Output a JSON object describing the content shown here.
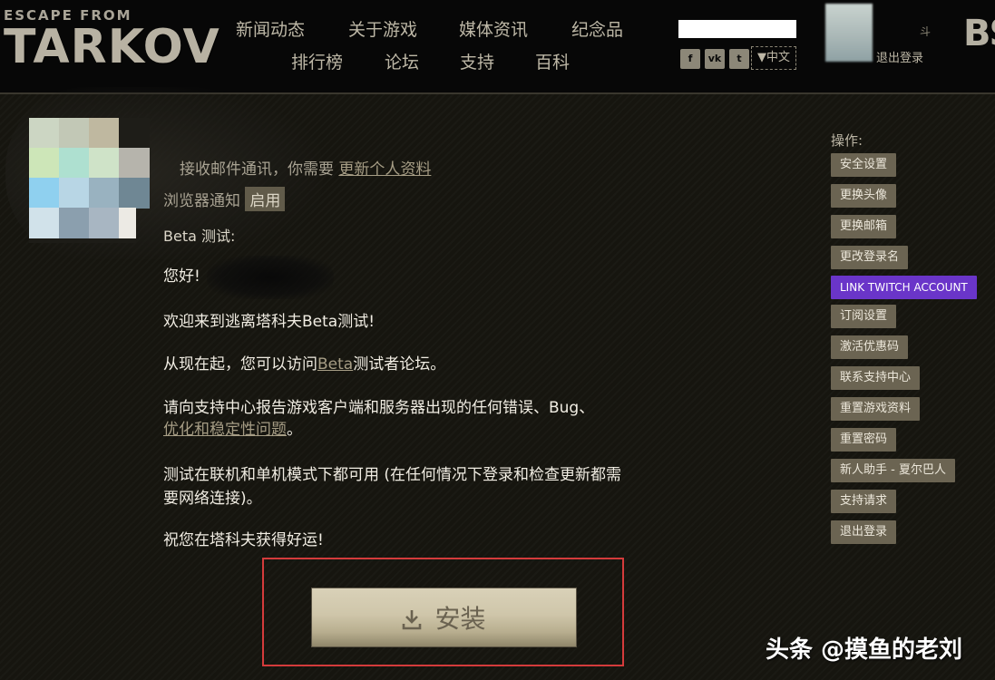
{
  "header": {
    "logo_line1": "ESCAPE FROM",
    "logo_line2": "TARKOV",
    "nav_row1": [
      "新闻动态",
      "关于游戏",
      "媒体资讯",
      "纪念品"
    ],
    "nav_row2": [
      "排行榜",
      "论坛",
      "支持",
      "百科"
    ],
    "social_icons": [
      "facebook-icon",
      "vk-icon",
      "twitter-icon"
    ],
    "language": "▼中文",
    "user_label": "斗",
    "logout": "退出登录",
    "brand_logo": "BSG"
  },
  "profile": {
    "email_notice_prefix": "接收邮件通讯，你需要",
    "email_notice_link": "更新个人资料",
    "browser_notify_label": "浏览器通知",
    "browser_notify_button": "启用",
    "beta_label": "Beta 测试:"
  },
  "message": {
    "greeting": "您好!",
    "welcome": "欢迎来到逃离塔科夫Beta测试!",
    "forum_prefix": "从现在起，您可以访问",
    "forum_link": "Beta",
    "forum_suffix": "测试者论坛。",
    "report_line1": "请向支持中心报告游戏客户端和服务器出现的任何错误、Bug、",
    "report_link": "优化和稳定性问题",
    "report_line2_suffix": "。",
    "modes_line1": "测试在联机和单机模式下都可用 (在任何情况下登录和检查更新都需",
    "modes_line2": "要网络连接)。",
    "good_luck": "祝您在塔科夫获得好运!"
  },
  "install": {
    "label": "安装",
    "icon": "download-icon"
  },
  "sidebar": {
    "title": "操作:",
    "items": [
      "安全设置",
      "更换头像",
      "更换邮箱",
      "更改登录名",
      "LINK TWITCH ACCOUNT",
      "订阅设置",
      "激活优惠码",
      "联系支持中心",
      "重置游戏资料",
      "重置密码",
      "新人助手 - 夏尔巴人",
      "支持请求",
      "退出登录"
    ]
  },
  "watermark": "头条 @摸鱼的老刘",
  "colors": {
    "accent_twitch": "#6a35c9",
    "button_bg": "#6b6452",
    "highlight_border": "#d43b3b"
  }
}
